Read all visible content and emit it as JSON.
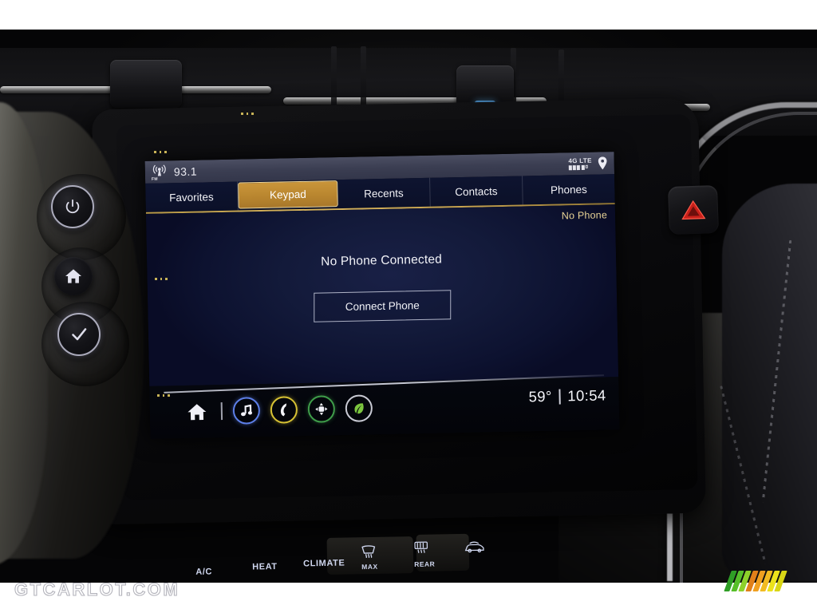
{
  "screen": {
    "status_bar": {
      "source_icon": "fm-radio-icon",
      "source_label": "FM",
      "frequency": "93.1",
      "network": "4G LTE",
      "signal_bars": 4,
      "location_icon": "map-pin-icon"
    },
    "tabs": [
      {
        "label": "Favorites",
        "active": false
      },
      {
        "label": "Keypad",
        "active": true
      },
      {
        "label": "Recents",
        "active": false
      },
      {
        "label": "Contacts",
        "active": false
      },
      {
        "label": "Phones",
        "active": false
      }
    ],
    "content": {
      "status_tag": "No Phone",
      "headline": "No Phone Connected",
      "button_label": "Connect Phone"
    },
    "dock": {
      "icons": [
        {
          "name": "home-icon",
          "ring": "none"
        },
        {
          "name": "music-note-icon",
          "ring": "blue"
        },
        {
          "name": "phone-handset-icon",
          "ring": "yellow"
        },
        {
          "name": "navigation-icon",
          "ring": "green"
        },
        {
          "name": "energy-leaf-icon",
          "ring": "white"
        }
      ],
      "temperature": "59°",
      "separator": "|",
      "time": "10:54"
    },
    "colors": {
      "accent_gold": "#c9953a",
      "tab_underline": "#c6a24e",
      "status_tag": "#e8d396",
      "screen_bg": "#131a3a",
      "statusbar_bg": "#3b3e52"
    }
  },
  "hardware": {
    "left_buttons": [
      {
        "name": "power-button",
        "icon": "power-icon",
        "lit": true
      },
      {
        "name": "home-button",
        "icon": "home-icon",
        "lit": false
      },
      {
        "name": "confirm-knob",
        "icon": "checkmark-icon",
        "lit": true
      }
    ],
    "hazard_button": {
      "name": "hazard-button",
      "icon": "hazard-triangle-icon",
      "color": "#d9261c"
    },
    "climate_controls": [
      {
        "label": "A/C"
      },
      {
        "label": "HEAT"
      },
      {
        "label": "CLIMATE"
      },
      {
        "label": "MAX",
        "icon": "front-defrost-icon"
      },
      {
        "label": "REAR",
        "icon": "rear-defrost-icon"
      },
      {
        "label": "",
        "icon": "car-recirculate-icon"
      }
    ]
  },
  "watermarks": {
    "site": "GTCARLOT.COM",
    "logo_colors": [
      "#3faa2e",
      "#5fbf2c",
      "#e8881b",
      "#f0a020",
      "#e8d81e",
      "#d9d615"
    ]
  }
}
